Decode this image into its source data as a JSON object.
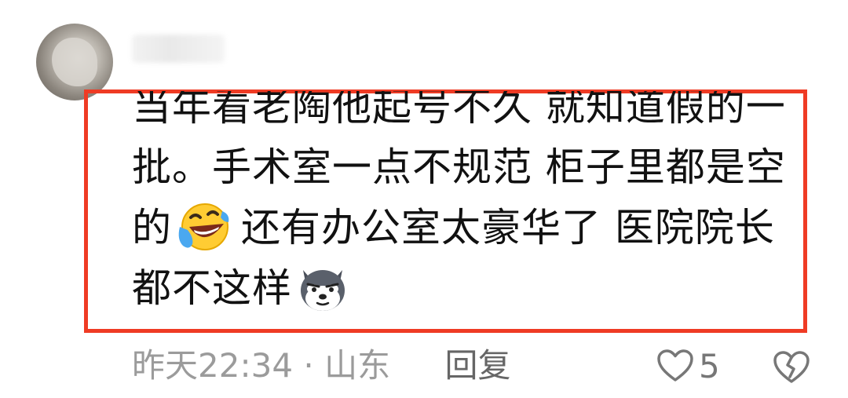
{
  "comment": {
    "lines": [
      "当年看老陶他起号不久 就知道假的一",
      "批。手术室一点不规范 柜子里都是空",
      "的",
      "还有办公室太豪华了 医院院长",
      "都不这样"
    ],
    "emojis": [
      "laughing-crying-emoji",
      "husky-dog-emoji"
    ]
  },
  "meta": {
    "time": "昨天22:34",
    "separator": "·",
    "location": "山东",
    "reply_label": "回复"
  },
  "actions": {
    "like_count": "5",
    "like_icon": "heart-icon",
    "dislike_icon": "broken-heart-icon"
  },
  "colors": {
    "highlight_border": "#ef3b24",
    "meta_text": "#9b9b9b"
  }
}
